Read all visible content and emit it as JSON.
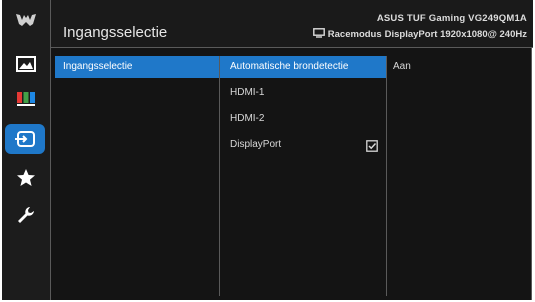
{
  "header": {
    "title": "Ingangsselectie",
    "model": "ASUS TUF Gaming  VG249QM1A",
    "mode": "Racemodus",
    "signal": "DisplayPort  1920x1080@ 240Hz"
  },
  "sidebar": {
    "icons": [
      "tuf-logo-icon",
      "image-icon",
      "color-icon",
      "input-select-icon",
      "star-icon",
      "wrench-icon"
    ],
    "active": "input-select-icon"
  },
  "menu": {
    "level1": [
      "Ingangsselectie"
    ],
    "level2": [
      "Automatische brondetectie",
      "HDMI-1",
      "HDMI-2",
      "DisplayPort"
    ],
    "level3": [
      "Aan"
    ],
    "checked_item": "DisplayPort"
  },
  "colors": {
    "accent": "#1f78c9",
    "background": "#141414",
    "sidebar": "#1c1c1c",
    "divider": "#5a5a5a",
    "text": "#d8d8d8"
  }
}
